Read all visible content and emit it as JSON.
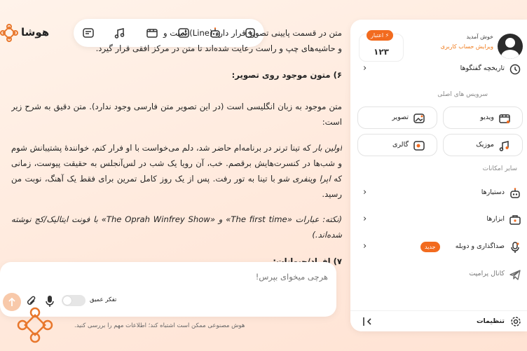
{
  "brand": {
    "name": "هوشا"
  },
  "toolbar": {
    "buttons": [
      "new-chat-icon",
      "robot-icon",
      "image-gen-icon",
      "video-gen-icon",
      "music-gen-icon",
      "gallery-icon"
    ]
  },
  "sidebar": {
    "user": {
      "greeting": "خوش آمدید",
      "edit_profile": "ویرایش حساب کاربری"
    },
    "credit": {
      "label": "⚡ اعتبار",
      "value": "۱۲۳"
    },
    "history": {
      "label": "تاریخچه گفتگوها"
    },
    "main_services_title": "سرویس های اصلی",
    "tiles": [
      {
        "label": "ویدیو",
        "icon": "video-icon"
      },
      {
        "label": "تصویر",
        "icon": "image-icon"
      },
      {
        "label": "موزیک",
        "icon": "music-icon"
      },
      {
        "label": "گالری",
        "icon": "gallery-icon"
      }
    ],
    "other_title": "سایر امکانات",
    "items": [
      {
        "label": "دستیارها",
        "icon": "robot-icon"
      },
      {
        "label": "ابزارها",
        "icon": "toolbox-icon"
      },
      {
        "label": "صداگذاری و دوبله",
        "icon": "microphone-icon",
        "badge": "جدید"
      },
      {
        "label": "کانال پرامپت",
        "icon": "telegram-icon"
      }
    ],
    "settings": {
      "label": "تنظیمات"
    }
  },
  "content": {
    "line1": "متن در قسمت پایینی تصویر قرار دارد (Line) است و",
    "line2": "و حاشیه‌های چپ و راست رعایت شده‌اند تا متن در مرکز افقی قرار گیرد.",
    "heading6": "۶) متون موجود روی تصویر:",
    "intro": "متن موجود به زبان انگلیسی است (در این تصویر متن فارسی وجود ندارد). متن دقیق به شرح زیر است:",
    "quote_first": "اولین بار",
    "quote_rest_a": " که تینا ترنر در برنامه‌ام حاضر شد، دلم می‌خواست با او فرار کنم، خوانندهٔ پشتیبانش شوم و شب‌ها در کنسرت‌هایش برقصم. خب، آن رویا یک شب در لس‌آنجلس به حقیقت پیوست، زمانی که ",
    "quote_show": "اپرا وینفری شو",
    "quote_rest_b": " با تینا به تور رفت. پس از یک روز کامل تمرین برای فقط یک آهنگ، نوبت من رسید.",
    "note": "(نکته: عبارات «The first time» و «The Oprah Winfrey Show» با فونت ایتالیک/کج نوشته شده‌اند.)",
    "heading7": "۷) افراد/حیوانات:"
  },
  "composer": {
    "placeholder": "هرچی میخوای بپرس!",
    "deep_think_label": "تفکر عمیق"
  },
  "disclaimer": "هوش مصنوعی ممکن است اشتباه کند؛ اطلاعات مهم را بررسی کنید.",
  "colors": {
    "accent": "#f26b1f",
    "background": "#ffeadf"
  }
}
